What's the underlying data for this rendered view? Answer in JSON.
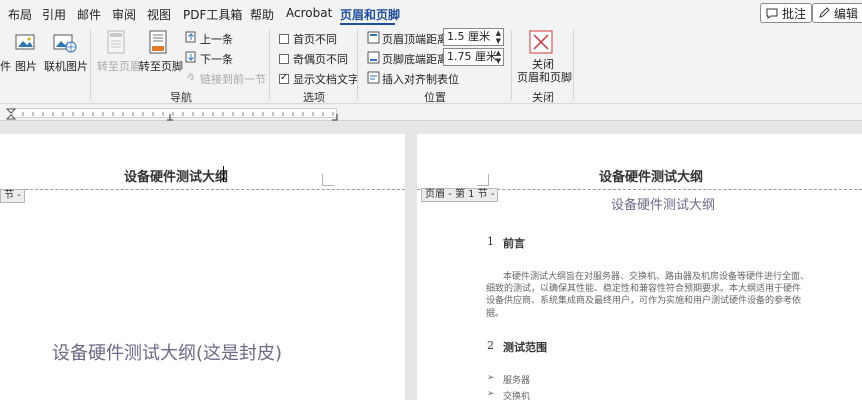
{
  "menu": {
    "items": [
      "布局",
      "引用",
      "邮件",
      "审阅",
      "视图",
      "PDF工具箱",
      "帮助",
      "Acrobat",
      "页眉和页脚"
    ],
    "active": "页眉和页脚",
    "comment_label": "批注",
    "edit_label": "编辑"
  },
  "ribbon": {
    "insert": {
      "partial": "件",
      "picture": "图片",
      "online_picture": "联机图片"
    },
    "navigation": {
      "goto_header": "转至页眉",
      "goto_footer": "转至页脚",
      "previous": "上一条",
      "next": "下一条",
      "link_previous": "链接到前一节",
      "label": "导航"
    },
    "options": {
      "diff_first": "首页不同",
      "diff_odd_even": "奇偶页不同",
      "show_doc_text": "显示文档文字",
      "label": "选项"
    },
    "position": {
      "header_top_label": "页眉顶端距离:",
      "header_top_value": "1.5 厘米",
      "footer_bottom_label": "页脚底端距离:",
      "footer_bottom_value": "1.75 厘米",
      "insert_align_tab": "插入对齐制表位",
      "label": "位置"
    },
    "close": {
      "button_line1": "关闭",
      "button_line2": "页眉和页脚",
      "label": "关闭"
    }
  },
  "left_page": {
    "header_title": "设备硬件测试大纲",
    "section_tag": "节 -",
    "cover_title": "设备硬件测试大纲(这是封皮)"
  },
  "right_page": {
    "header_title": "设备硬件测试大纲",
    "header_tag": "页眉 - 第 1 节 -",
    "doc_title": "设备硬件测试大纲",
    "s1_num": "1",
    "s1_title": "前言",
    "para1": "本硬件测试大纲旨在对服务器、交换机、路由器及机房设备等硬件进行全面、",
    "para2": "细致的测试，以确保其性能、稳定性和兼容性符合预期要求。本大纲适用于硬件",
    "para3": "设备供应商、系统集成商及最终用户，可作为实施和用户测试硬件设备的参考依",
    "para4": "据。",
    "s2_num": "2",
    "s2_title": "测试范围",
    "bullet1": "服务器",
    "bullet2": "交换机"
  },
  "colors": {
    "accent": "#1f4e9b",
    "close_red": "#d13438"
  }
}
